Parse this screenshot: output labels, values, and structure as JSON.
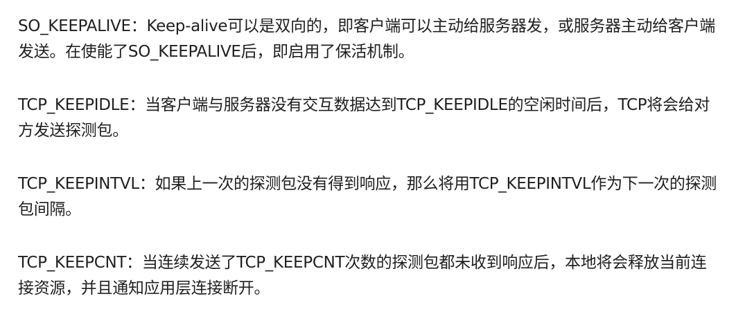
{
  "paragraphs": [
    {
      "term": "SO_KEEPALIVE",
      "sep": "：",
      "text": "Keep-alive可以是双向的，即客户端可以主动给服务器发，或服务器主动给客户端发送。在使能了SO_KEEPALIVE后，即启用了保活机制。"
    },
    {
      "term": "TCP_KEEPIDLE",
      "sep": "：",
      "text": "当客户端与服务器没有交互数据达到TCP_KEEPIDLE的空闲时间后，TCP将会给对方发送探测包。"
    },
    {
      "term": "TCP_KEEPINTVL",
      "sep": "：",
      "text": "如果上一次的探测包没有得到响应，那么将用TCP_KEEPINTVL作为下一次的探测包间隔。"
    },
    {
      "term": "TCP_KEEPCNT",
      "sep": "：",
      "text": "当连续发送了TCP_KEEPCNT次数的探测包都未收到响应后，本地将会释放当前连接资源，并且通知应用层连接断开。"
    }
  ]
}
